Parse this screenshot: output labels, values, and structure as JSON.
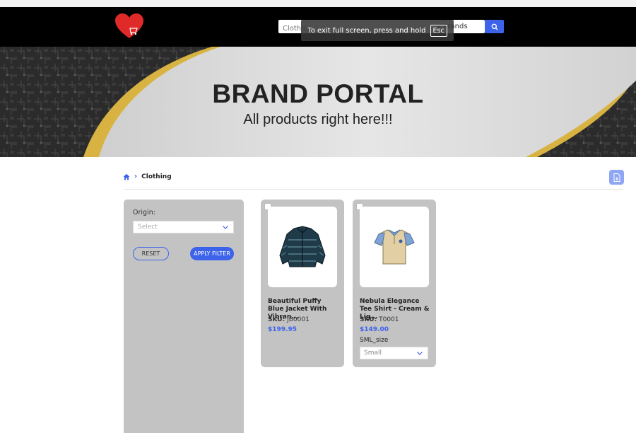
{
  "header": {
    "search_placeholder": "Clothing",
    "search_suffix": "y brands"
  },
  "fullscreen_notice": {
    "text": "To exit full screen, press and hold",
    "key": "Esc"
  },
  "hero": {
    "title": "BRAND PORTAL",
    "subtitle": "All products right here!!!"
  },
  "breadcrumb": {
    "current": "Clothing"
  },
  "filters": {
    "origin_label": "Origin:",
    "origin_placeholder": "Select",
    "reset_label": "RESET",
    "apply_label": "APPLY FILTER"
  },
  "products": [
    {
      "name": "Beautiful Puffy Blue Jacket With Vibran...",
      "sku_label": "SKU:",
      "sku": "JB0001",
      "price": "$199.95",
      "image_icon": "puffer-jacket-icon"
    },
    {
      "name": "Nebula Elegance Tee Shirt - Cream & Lig...",
      "sku_label": "SKU:",
      "sku": "T0001",
      "price": "$149.00",
      "attribute_label": "SML_size",
      "size_selected": "Small",
      "image_icon": "polo-shirt-icon"
    }
  ],
  "colors": {
    "accent": "#3d63ea",
    "header_bg": "#000000",
    "panel_bg": "#c3c3c3",
    "hero_wave": "#d8b341"
  }
}
